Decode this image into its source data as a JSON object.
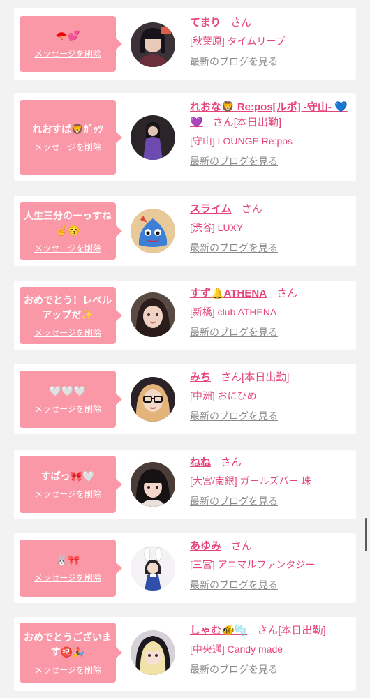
{
  "theme": {
    "accent": "#e6457a",
    "bubble": "#fa98a8",
    "page_bg": "#f2f2f2",
    "link_gray": "#8a8a8a"
  },
  "labels": {
    "delete": "メッセージを削除",
    "blog": "最新のブログを見る",
    "san": "さん"
  },
  "items": [
    {
      "message": "🪭💕",
      "name": "てまり",
      "working": "",
      "shop": "[秋葉原] タイムリープ",
      "avatar_icon": "avatar-photo-icon"
    },
    {
      "message": "れおすぱ🦁ｶﾞｯﾂ",
      "name": "れおな🦁 Re:pos[ルポ] -守山- 💙💜",
      "working": "[本日出勤]",
      "shop": "[守山] LOUNGE Re:pos",
      "avatar_icon": "avatar-photo-icon"
    },
    {
      "message": "人生三分の一っすね✌️😚",
      "name": "スライム",
      "working": "",
      "shop": "[渋谷] LUXY",
      "avatar_icon": "avatar-slime-icon"
    },
    {
      "message": "おめでとう！レベルアップだ✨",
      "name": "すず🔔ATHENA",
      "working": "",
      "shop": "[新橋] club ATHENA",
      "avatar_icon": "avatar-photo-icon"
    },
    {
      "message": "🤍🤍🤍",
      "name": "みち",
      "working": "[本日出勤]",
      "shop": "[中洲] おにひめ",
      "avatar_icon": "avatar-photo-icon"
    },
    {
      "message": "すぱっ🎀🤍",
      "name": "ねね",
      "working": "",
      "shop": "[大宮/南銀] ガールズバー 珠",
      "avatar_icon": "avatar-photo-icon"
    },
    {
      "message": "🐰🎀",
      "name": "あゆみ",
      "working": "",
      "shop": "[三宮] アニマルファンタジー",
      "avatar_icon": "avatar-photo-icon"
    },
    {
      "message": "おめでとうございます㊗️🎉",
      "name": "しゃむ🐠🫧",
      "working": "[本日出勤]",
      "shop": "[中央通] Candy made",
      "avatar_icon": "avatar-photo-icon"
    }
  ]
}
